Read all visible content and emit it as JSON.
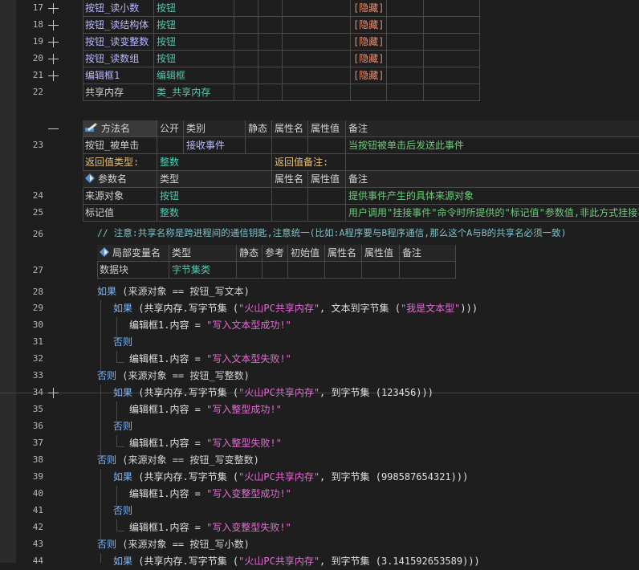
{
  "line_numbers": [
    "17",
    "18",
    "19",
    "20",
    "21",
    "22",
    "23",
    "24",
    "25",
    "26",
    "27",
    "28",
    "29",
    "30",
    "31",
    "32",
    "33",
    "34",
    "35",
    "36",
    "37",
    "38",
    "39",
    "40",
    "41",
    "42",
    "43",
    "44"
  ],
  "vars": [
    {
      "name": "按钮_读小数",
      "type": "按钮",
      "attr": "[隐藏]"
    },
    {
      "name": "按钮_读结构体",
      "type": "按钮",
      "attr": "[隐藏]"
    },
    {
      "name": "按钮_读变整数",
      "type": "按钮",
      "attr": "[隐藏]"
    },
    {
      "name": "按钮_读数组",
      "type": "按钮",
      "attr": "[隐藏]"
    },
    {
      "name": "编辑框1",
      "type": "编辑框",
      "attr": "[隐藏]"
    },
    {
      "name": "共享内存",
      "type": "类_共享内存",
      "attr": ""
    }
  ],
  "method_header": {
    "name": "方法名",
    "public": "公开",
    "kind": "类别",
    "static": "静态",
    "attr_name": "属性名",
    "attr_value": "属性值",
    "note": "备注"
  },
  "method": {
    "name": "按钮_被单击",
    "kind": "接收事件",
    "note": "当按钮被单击后发送此事件"
  },
  "return_row": {
    "label": "返回值类型:",
    "type": "整数",
    "note_label": "返回值备注:"
  },
  "param_header": {
    "name": "参数名",
    "type": "类型",
    "attr_name": "属性名",
    "attr_value": "属性值",
    "note": "备注"
  },
  "params": [
    {
      "name": "来源对象",
      "type": "按钮",
      "note": "提供事件产生的具体来源对象"
    },
    {
      "name": "标记值",
      "type": "整数",
      "note": "用户调用\"挂接事件\"命令时所提供的\"标记值\"参数值,非此方式挂接事件"
    }
  ],
  "comment_line": "// 注意:共享名称是跨进程间的通信钥匙,注意统一(比如:A程序要与B程序通信,那么这个A与B的共享名必须一致)",
  "local_header": {
    "name": "局部变量名",
    "type": "类型",
    "static": "静态",
    "ref": "参考",
    "init": "初始值",
    "attr_name": "属性名",
    "attr_value": "属性值",
    "note": "备注"
  },
  "local_var": {
    "name": "数据块",
    "type": "字节集类"
  },
  "code": {
    "kw_if": "如果",
    "kw_else": "否则",
    "cond1": " (来源对象 == 按钮_写文本)",
    "cond2": " (来源对象 == 按钮_写整数)",
    "cond3": " (来源对象 == 按钮_写变整数)",
    "cond4": " (来源对象 == 按钮_写小数)",
    "write_prefix": " (共享内存.写字节集 (",
    "share_name": "\"火山PC共享内存\"",
    "call1_mid": ", 文本到字节集 (",
    "call1_arg": "\"我是文本型\"",
    "call1_end": ")))",
    "call2_mid": ", 到字节集 (123456)))",
    "call3_mid": ", 到字节集 (998587654321)))",
    "call4_mid": ", 到字节集 (3.141592653589)))",
    "edit_prefix": "编辑框1.内容 = ",
    "msg_text_ok": "\"写入文本型成功!\"",
    "msg_text_fail": "\"写入文本型失败!\"",
    "msg_int_ok": "\"写入整型成功!\"",
    "msg_int_fail": "\"写入整型失败!\"",
    "msg_vint_ok": "\"写入变整型成功!\"",
    "msg_vint_fail": "\"写入变整型失败!\""
  },
  "icons": {
    "method": "pencil-key-icon",
    "param": "blue-diamond-icon",
    "local": "blue-diamond-icon"
  }
}
